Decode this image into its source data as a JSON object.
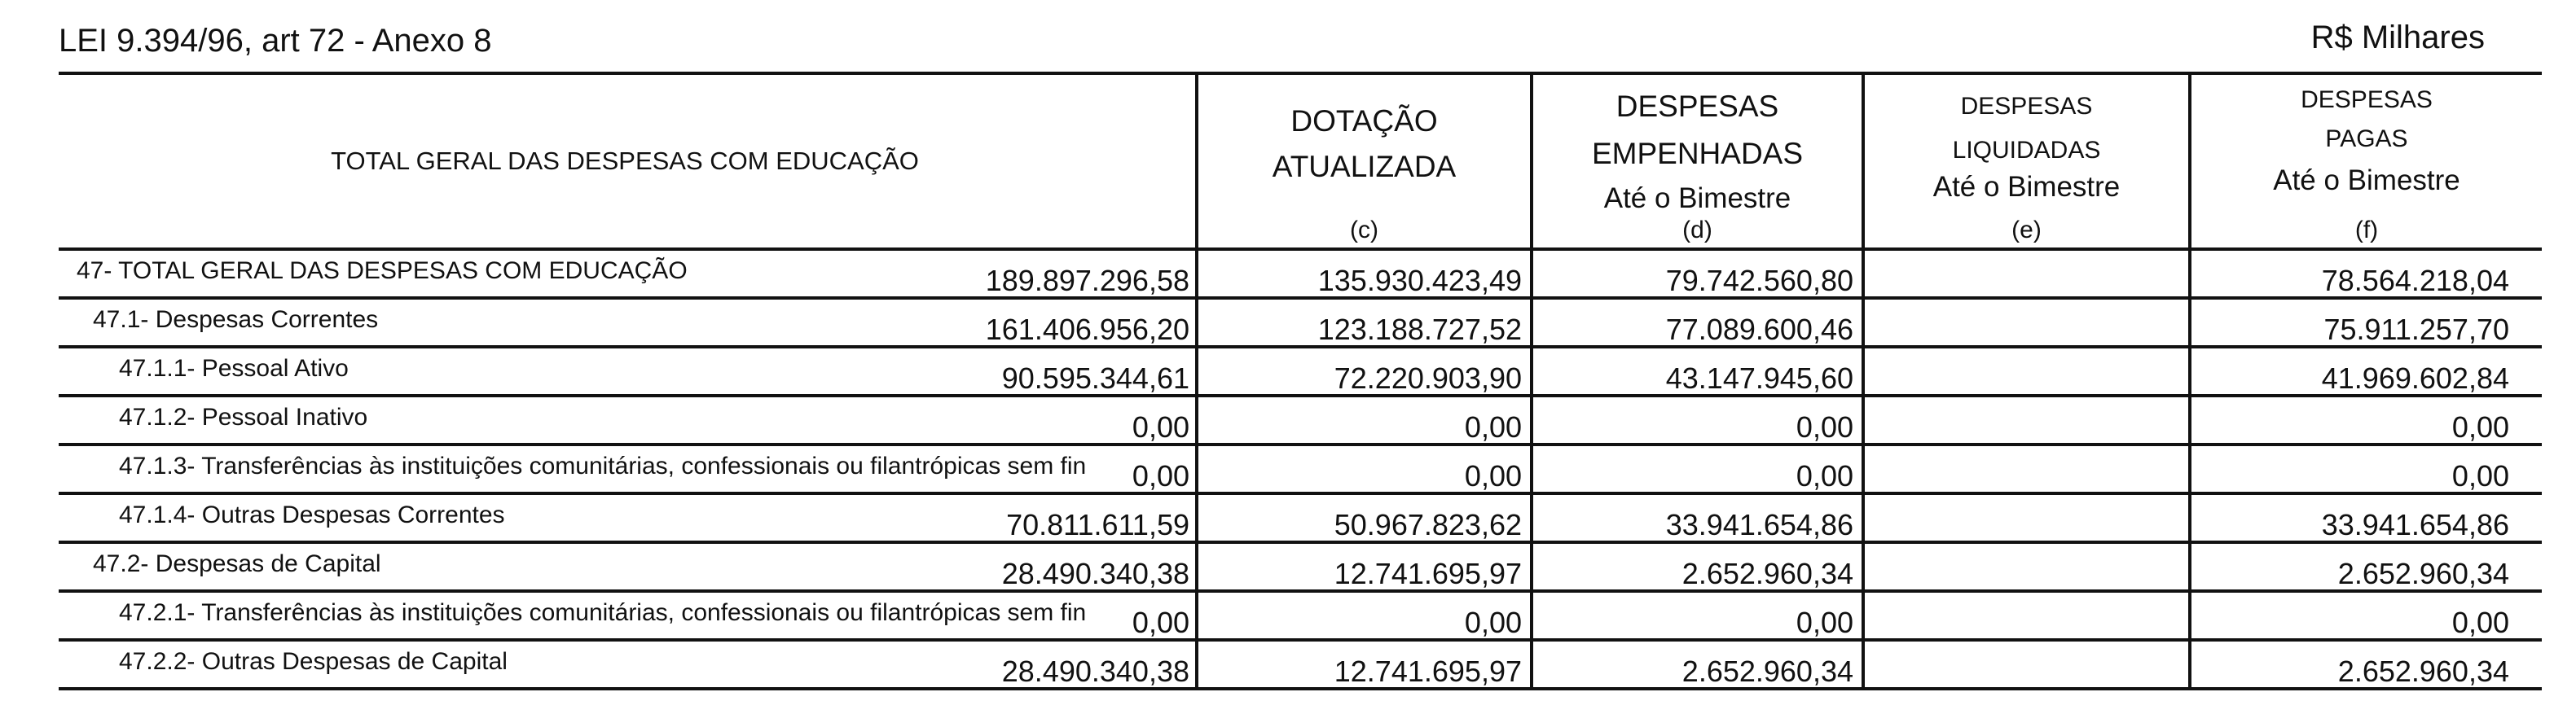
{
  "header": {
    "left": "LEI 9.394/96, art 72 - Anexo 8",
    "right": "R$ Milhares"
  },
  "table": {
    "title": "TOTAL GERAL DAS DESPESAS COM EDUCAÇÃO",
    "columns": [
      {
        "line1": "DOTAÇÃO",
        "line2": "ATUALIZADA",
        "line3": "",
        "code": "(c)"
      },
      {
        "line1": "DESPESAS",
        "line2": "EMPENHADAS",
        "line3": "Até o Bimestre",
        "code": "(d)"
      },
      {
        "line1": "DESPESAS",
        "line2": "LIQUIDADAS",
        "line3": "Até o Bimestre",
        "code": "(e)"
      },
      {
        "line1": "DESPESAS",
        "line2": "PAGAS",
        "line3": "Até o Bimestre",
        "code": "(f)"
      }
    ],
    "rows": [
      {
        "label": "47- TOTAL GERAL DAS DESPESAS COM EDUCAÇÃO",
        "values": [
          "189.897.296,58",
          "135.930.423,49",
          "79.742.560,80",
          "78.564.218,04"
        ]
      },
      {
        "label": "47.1- Despesas Correntes",
        "values": [
          "161.406.956,20",
          "123.188.727,52",
          "77.089.600,46",
          "75.911.257,70"
        ]
      },
      {
        "label": "47.1.1- Pessoal Ativo",
        "values": [
          "90.595.344,61",
          "72.220.903,90",
          "43.147.945,60",
          "41.969.602,84"
        ]
      },
      {
        "label": "47.1.2- Pessoal Inativo",
        "values": [
          "0,00",
          "0,00",
          "0,00",
          "0,00"
        ]
      },
      {
        "label": "47.1.3- Transferências às instituições comunitárias, confessionais ou filantrópicas sem fin",
        "values": [
          "0,00",
          "0,00",
          "0,00",
          "0,00"
        ]
      },
      {
        "label": "47.1.4- Outras Despesas Correntes",
        "values": [
          "70.811.611,59",
          "50.967.823,62",
          "33.941.654,86",
          "33.941.654,86"
        ]
      },
      {
        "label": "47.2- Despesas de Capital",
        "values": [
          "28.490.340,38",
          "12.741.695,97",
          "2.652.960,34",
          "2.652.960,34"
        ]
      },
      {
        "label": "47.2.1- Transferências às instituições comunitárias, confessionais ou filantrópicas sem fin",
        "values": [
          "0,00",
          "0,00",
          "0,00",
          "0,00"
        ]
      },
      {
        "label": "47.2.2- Outras Despesas de Capital",
        "values": [
          "28.490.340,38",
          "12.741.695,97",
          "2.652.960,34",
          "2.652.960,34"
        ]
      }
    ]
  }
}
